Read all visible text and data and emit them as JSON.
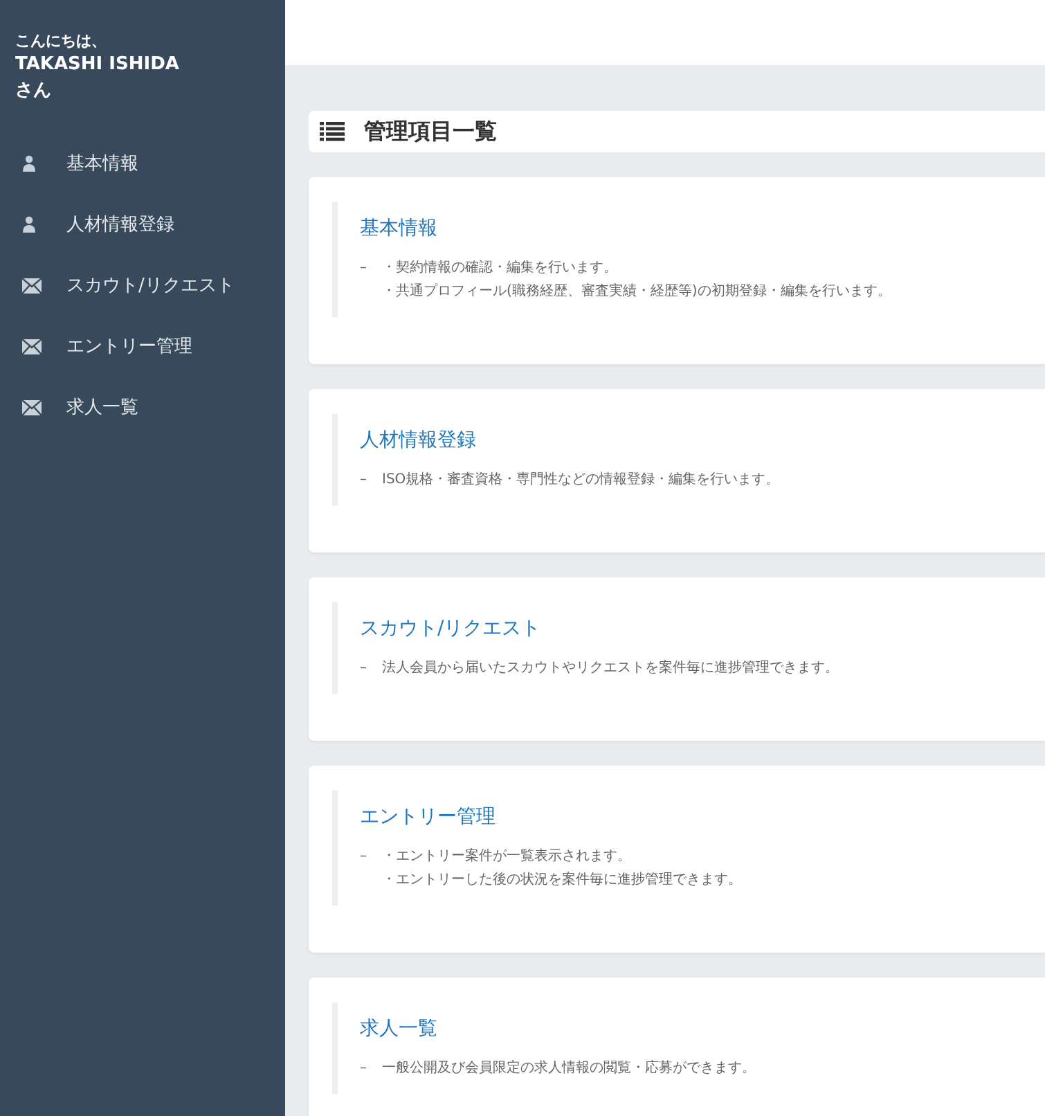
{
  "sidebar": {
    "greeting": "こんにちは、",
    "user_name": "TAKASHI ISHIDA",
    "honorific": "さん",
    "items": [
      {
        "label": "基本情報",
        "kind": "person"
      },
      {
        "label": "人材情報登録",
        "kind": "person"
      },
      {
        "label": "スカウト/リクエスト",
        "kind": "message"
      },
      {
        "label": "エントリー管理",
        "kind": "message"
      },
      {
        "label": "求人一覧",
        "kind": "message"
      }
    ]
  },
  "page_title": "管理項目一覧",
  "cards": [
    {
      "title": "基本情報",
      "dash": "–",
      "lines": [
        "・契約情報の確認・編集を行います。",
        "・共通プロフィール(職務経歴、審査実績・経歴等)の初期登録・編集を行います。"
      ]
    },
    {
      "title": "人材情報登録",
      "dash": "–",
      "lines": [
        "ISO規格・審査資格・専門性などの情報登録・編集を行います。"
      ]
    },
    {
      "title": "スカウト/リクエスト",
      "dash": "–",
      "lines": [
        "法人会員から届いたスカウトやリクエストを案件毎に進捗管理できます。"
      ]
    },
    {
      "title": "エントリー管理",
      "dash": "–",
      "lines": [
        "・エントリー案件が一覧表示されます。",
        "・エントリーした後の状況を案件毎に進捗管理できます。"
      ]
    },
    {
      "title": "求人一覧",
      "dash": "–",
      "lines": [
        "一般公開及び会員限定の求人情報の閲覧・応募ができます。"
      ]
    }
  ]
}
